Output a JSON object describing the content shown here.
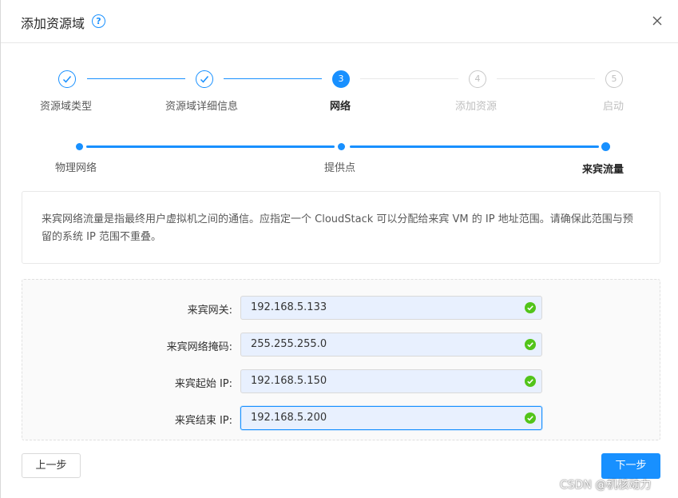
{
  "dialog": {
    "title": "添加资源域",
    "help_icon": "question-circle-icon",
    "close_icon": "close-icon"
  },
  "steps": [
    {
      "label": "资源域类型",
      "number": "1",
      "status": "finish"
    },
    {
      "label": "资源域详细信息",
      "number": "2",
      "status": "finish"
    },
    {
      "label": "网络",
      "number": "3",
      "status": "process"
    },
    {
      "label": "添加资源",
      "number": "4",
      "status": "wait"
    },
    {
      "label": "启动",
      "number": "5",
      "status": "wait"
    }
  ],
  "sub_steps": [
    {
      "label": "物理网络",
      "status": "finish"
    },
    {
      "label": "提供点",
      "status": "finish"
    },
    {
      "label": "来宾流量",
      "status": "process"
    }
  ],
  "description": "来宾网络流量是指最终用户虚拟机之间的通信。应指定一个 CloudStack 可以分配给来宾 VM 的 IP 地址范围。请确保此范围与预留的系统 IP 范围不重叠。",
  "form": {
    "fields": [
      {
        "label": "来宾网关:",
        "value": "192.168.5.133",
        "valid": true
      },
      {
        "label": "来宾网络掩码:",
        "value": "255.255.255.0",
        "valid": true
      },
      {
        "label": "来宾起始 IP:",
        "value": "192.168.5.150",
        "valid": true
      },
      {
        "label": "来宾结束 IP:",
        "value": "192.168.5.200",
        "valid": true
      }
    ]
  },
  "buttons": {
    "prev": "上一步",
    "next": "下一步"
  },
  "watermark": "CSDN @机核动力",
  "colors": {
    "primary": "#1890ff",
    "success": "#52c41a",
    "input_bg": "#e8f0fe"
  }
}
